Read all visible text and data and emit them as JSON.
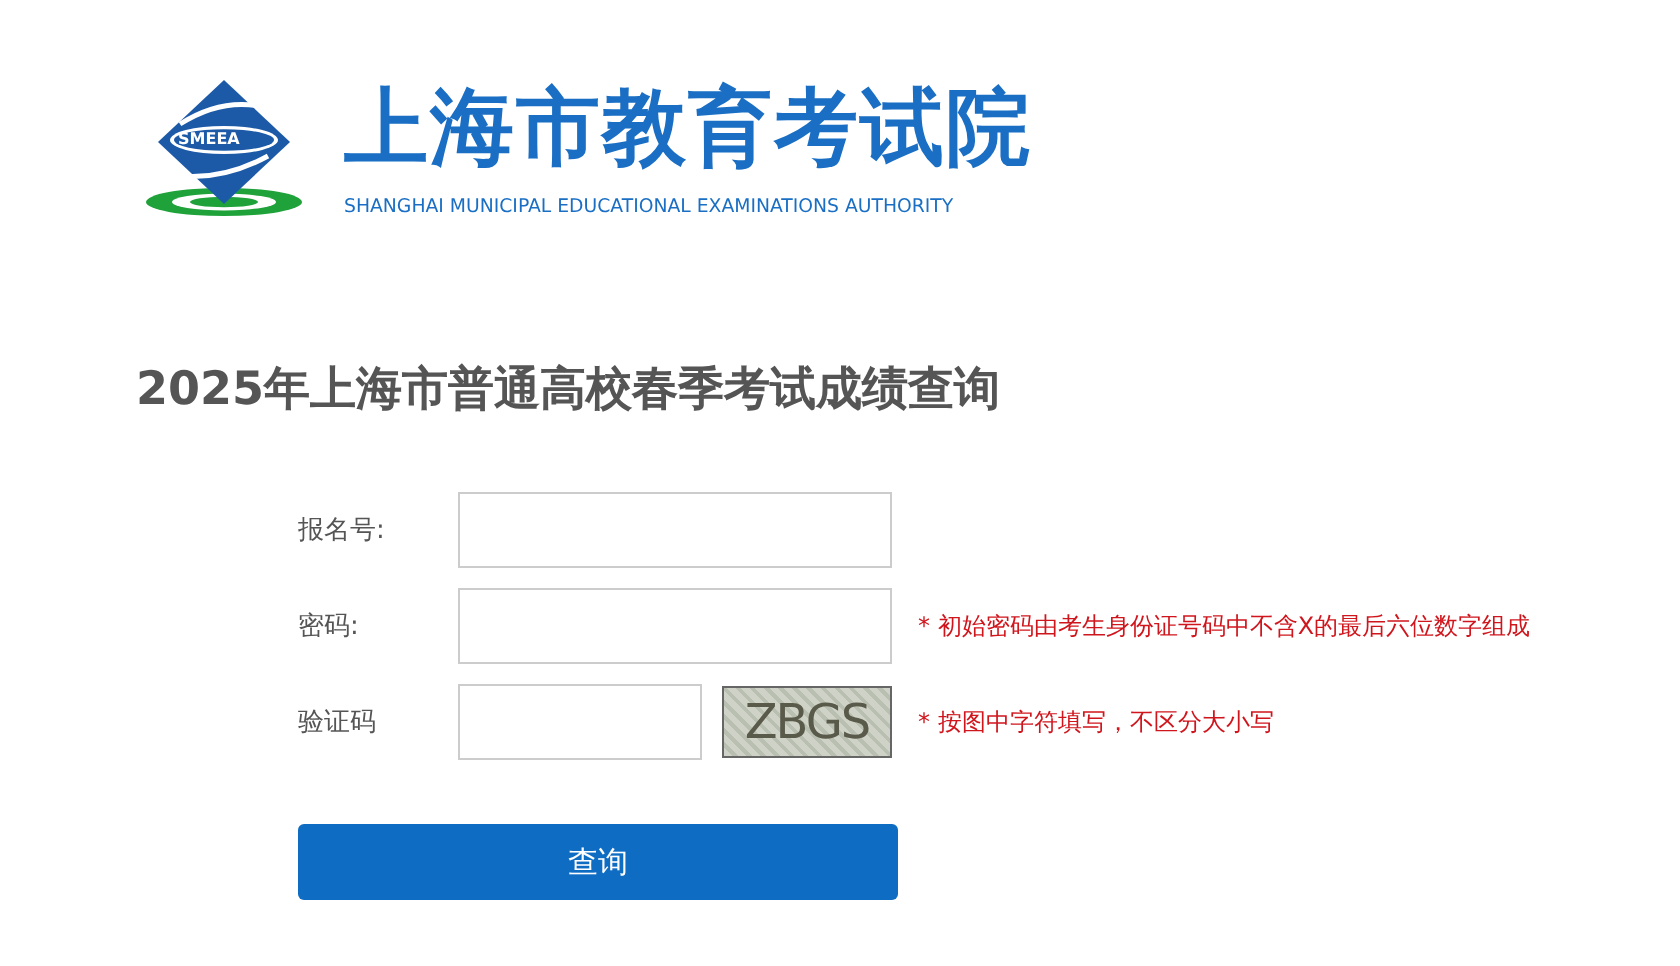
{
  "header": {
    "logo_text": "SMEEA",
    "title": "上海市教育考试院",
    "subtitle": "SHANGHAI MUNICIPAL EDUCATIONAL EXAMINATIONS AUTHORITY"
  },
  "heading": "2025年上海市普通高校春季考试成绩查询",
  "fields": [
    {
      "kind": "text",
      "label": "报名号:"
    },
    {
      "kind": "password",
      "label": "密码:",
      "hint": "* 初始密码由考生身份证号码中不含X的最后六位数字组成"
    },
    {
      "kind": "captcha",
      "label": "验证码",
      "captcha": "ZBGS",
      "hint": "* 按图中字符填写，不区分大小写"
    }
  ],
  "submit": "查询"
}
